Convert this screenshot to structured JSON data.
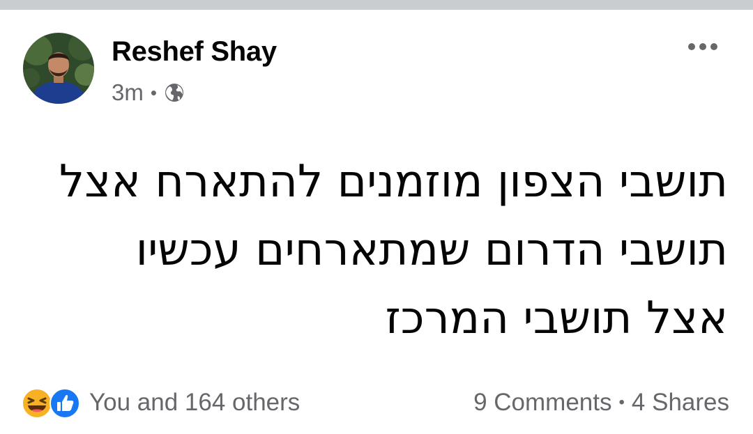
{
  "post": {
    "author": "Reshef Shay",
    "time": "3m",
    "separator": "•",
    "audience_icon": "globe-icon",
    "more_icon": "more-options-icon",
    "text_lines": [
      "תושבי הצפון מוזמנים להתארח אצל",
      "תושבי הדרום שמתארחים עכשיו",
      "אצל תושבי המרכז"
    ]
  },
  "footer": {
    "reactions_icons": [
      "haha-reaction-icon",
      "like-reaction-icon"
    ],
    "reactions_text": "You and 164 others",
    "comments": "9 Comments",
    "separator": "•",
    "shares": "4 Shares"
  },
  "colors": {
    "primary_text": "#050505",
    "secondary_text": "#65676b",
    "like_blue": "#1877f2",
    "haha_yellow": "#f7b125"
  }
}
